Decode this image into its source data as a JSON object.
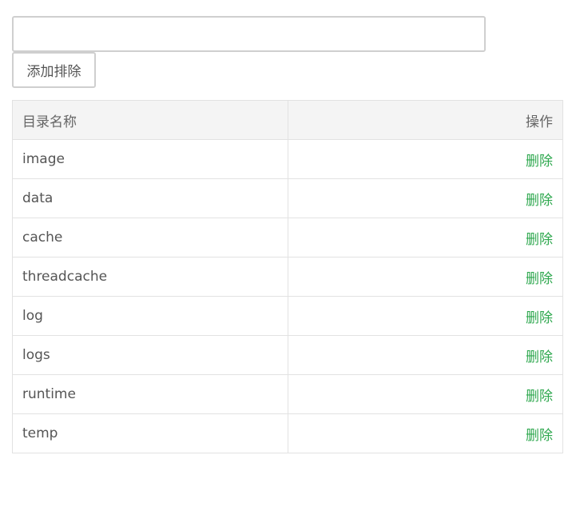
{
  "form": {
    "directory_input": {
      "value": "",
      "placeholder": ""
    },
    "add_button_label": "添加排除"
  },
  "table": {
    "headers": {
      "name": "目录名称",
      "action": "操作"
    },
    "rows": [
      {
        "name": "image",
        "action": "删除"
      },
      {
        "name": "data",
        "action": "删除"
      },
      {
        "name": "cache",
        "action": "删除"
      },
      {
        "name": "threadcache",
        "action": "删除"
      },
      {
        "name": "log",
        "action": "删除"
      },
      {
        "name": "logs",
        "action": "删除"
      },
      {
        "name": "runtime",
        "action": "删除"
      },
      {
        "name": "temp",
        "action": "删除"
      }
    ]
  },
  "colors": {
    "delete_link": "#2fa84f",
    "header_bg": "#f4f4f4",
    "border": "#e2e2e2"
  }
}
